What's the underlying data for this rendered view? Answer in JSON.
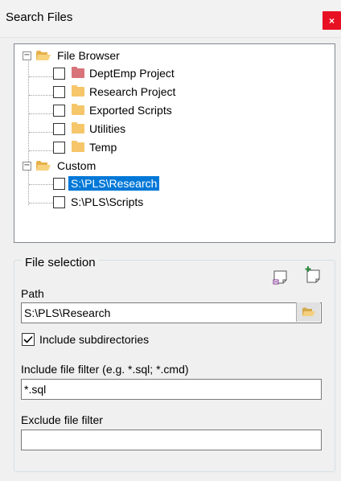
{
  "window": {
    "title": "Search Files",
    "close_glyph": "×"
  },
  "tree": {
    "root_groups": [
      {
        "label": "File Browser",
        "expander": "−",
        "children": [
          {
            "label": "DeptEmp Project",
            "folder_color": "#d9737a",
            "checked": false
          },
          {
            "label": "Research Project",
            "folder_color": "#f6c66a",
            "checked": false
          },
          {
            "label": "Exported Scripts",
            "folder_color": "#f6c66a",
            "checked": false
          },
          {
            "label": "Utilities",
            "folder_color": "#f6c66a",
            "checked": false
          },
          {
            "label": "Temp",
            "folder_color": "#f6c66a",
            "checked": false
          }
        ]
      },
      {
        "label": "Custom",
        "expander": "−",
        "children": [
          {
            "label": "S:\\PLS\\Research",
            "selected": true,
            "checked": false
          },
          {
            "label": "S:\\PLS\\Scripts",
            "selected": false,
            "checked": false
          }
        ]
      }
    ]
  },
  "file_selection": {
    "legend": "File selection",
    "path_label": "Path",
    "path_value": "S:\\PLS\\Research",
    "include_subdirs_label": "Include subdirectories",
    "include_subdirs_checked": true,
    "include_filter_label": "Include file filter (e.g. *.sql; *.cmd)",
    "include_filter_value": "*.sql",
    "exclude_filter_label": "Exclude file filter",
    "exclude_filter_value": ""
  },
  "colors": {
    "selection": "#0078d7",
    "close": "#e81123",
    "folder_yellow": "#f6c66a",
    "folder_red": "#d9737a"
  },
  "icons": [
    "folder-open-icon",
    "folder-icon",
    "remove-item-icon",
    "add-item-icon",
    "browse-folder-icon",
    "check-icon",
    "close-icon",
    "collapse-icon"
  ]
}
